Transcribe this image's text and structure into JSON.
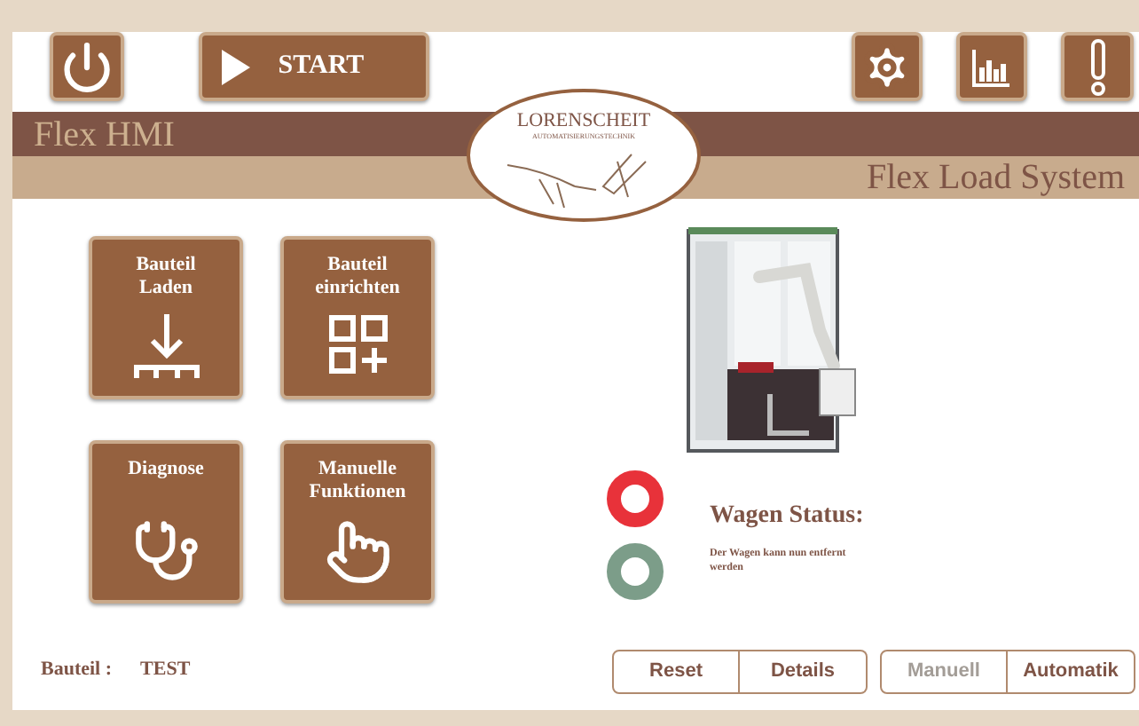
{
  "toolbar": [
    {
      "kind": "power"
    },
    {
      "kind": "start",
      "label": "START"
    },
    {
      "kind": "spacer"
    },
    {
      "kind": "settings"
    },
    {
      "kind": "chart"
    },
    {
      "kind": "alert"
    }
  ],
  "title": "Flex HMI",
  "subtitle": "Flex Load System",
  "logo": {
    "name": "LORENSCHEIT",
    "tagline": "AUTOMATISIERUNGSTECHNIK"
  },
  "tiles": [
    {
      "kind": "load",
      "label": [
        "Bauteil",
        "Laden"
      ]
    },
    {
      "kind": "setup",
      "label": [
        "Bauteil",
        "einrichten"
      ]
    },
    {
      "kind": "diagnose",
      "label": [
        "Diagnose"
      ]
    },
    {
      "kind": "manual",
      "label": [
        "Manuelle",
        "Funktionen"
      ]
    }
  ],
  "lights": [
    {
      "color": "#e8323a"
    },
    {
      "color": "#7c9d89"
    }
  ],
  "status": {
    "title": "Wagen Status:",
    "message": "Der Wagen kann nun entfernt werden"
  },
  "part": {
    "label": "Bauteil :",
    "value": "TEST"
  },
  "button_groups": [
    [
      {
        "label": "Reset",
        "disabled": false
      },
      {
        "label": "Details",
        "disabled": false
      }
    ],
    [
      {
        "label": "Manuell",
        "disabled": true
      },
      {
        "label": "Automatik",
        "disabled": false
      }
    ]
  ]
}
